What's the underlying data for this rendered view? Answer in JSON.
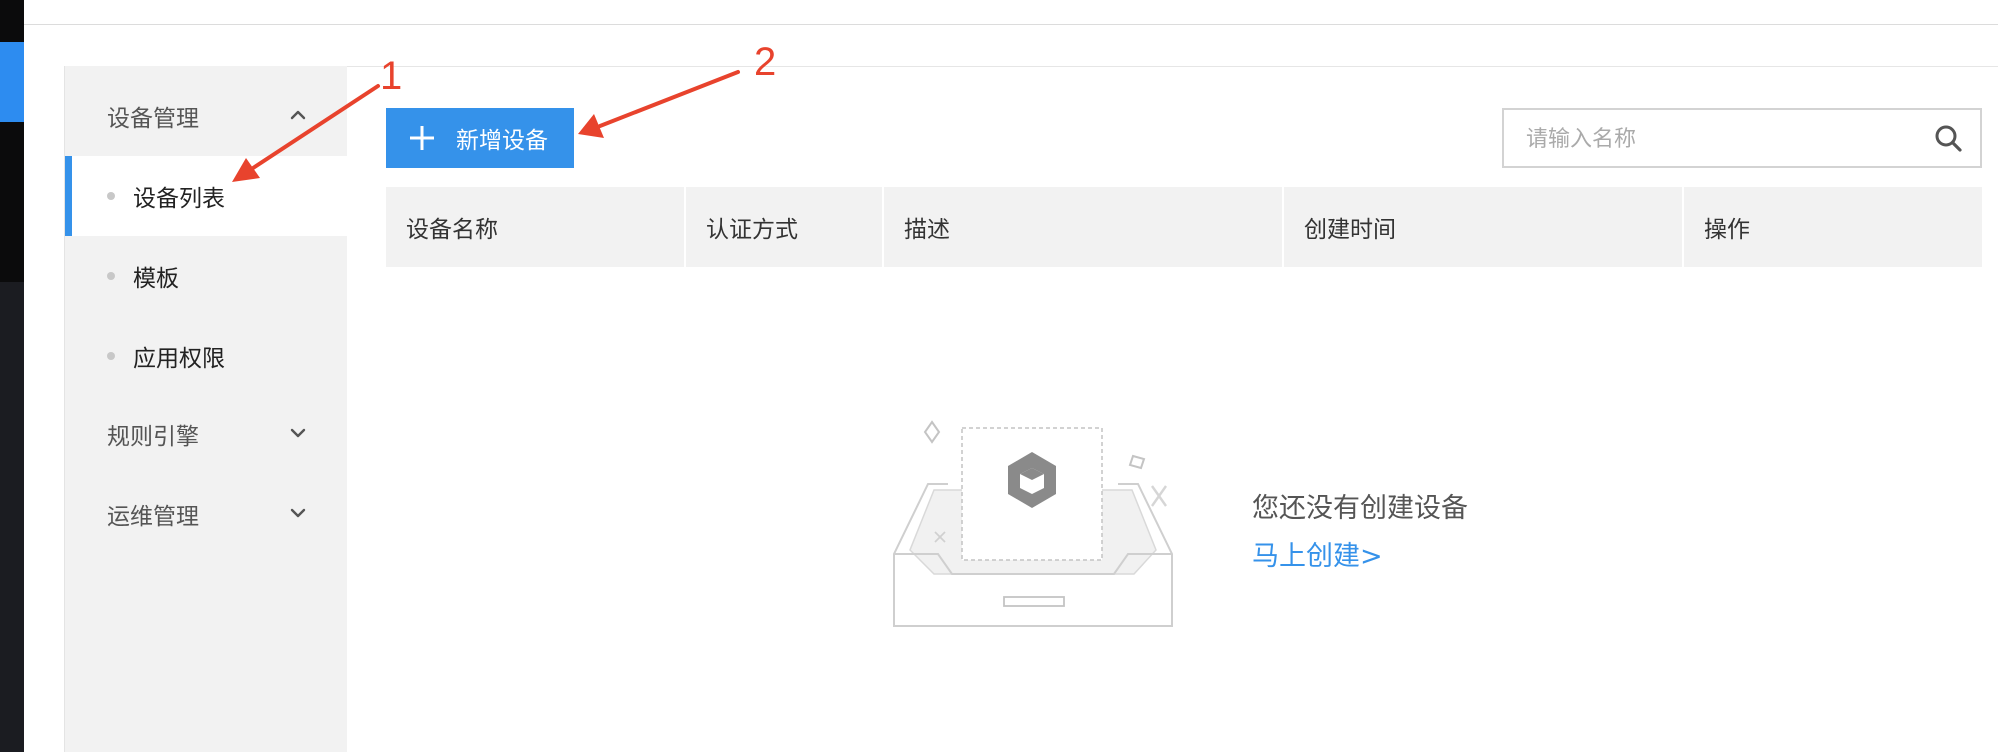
{
  "sidebar": {
    "groups": [
      {
        "label": "设备管理",
        "expanded": true,
        "items": [
          "设备列表",
          "模板",
          "应用权限"
        ]
      },
      {
        "label": "规则引擎",
        "expanded": false
      },
      {
        "label": "运维管理",
        "expanded": false
      }
    ],
    "active_item": "设备列表"
  },
  "toolbar": {
    "add_label": "新增设备",
    "add_icon": "plus-icon",
    "search": {
      "placeholder": "请输入名称",
      "value": "",
      "icon": "search-icon"
    }
  },
  "table": {
    "columns": [
      "设备名称",
      "认证方式",
      "描述",
      "创建时间",
      "操作"
    ],
    "rows": []
  },
  "empty_state": {
    "title": "您还没有创建设备",
    "link": "马上创建>"
  },
  "annotations": {
    "labels": [
      "1",
      "2"
    ],
    "color": "#e8432d"
  },
  "colors": {
    "accent": "#3592ea",
    "sidebar_bg": "#f2f2f2",
    "header_bg": "#f2f2f2"
  }
}
